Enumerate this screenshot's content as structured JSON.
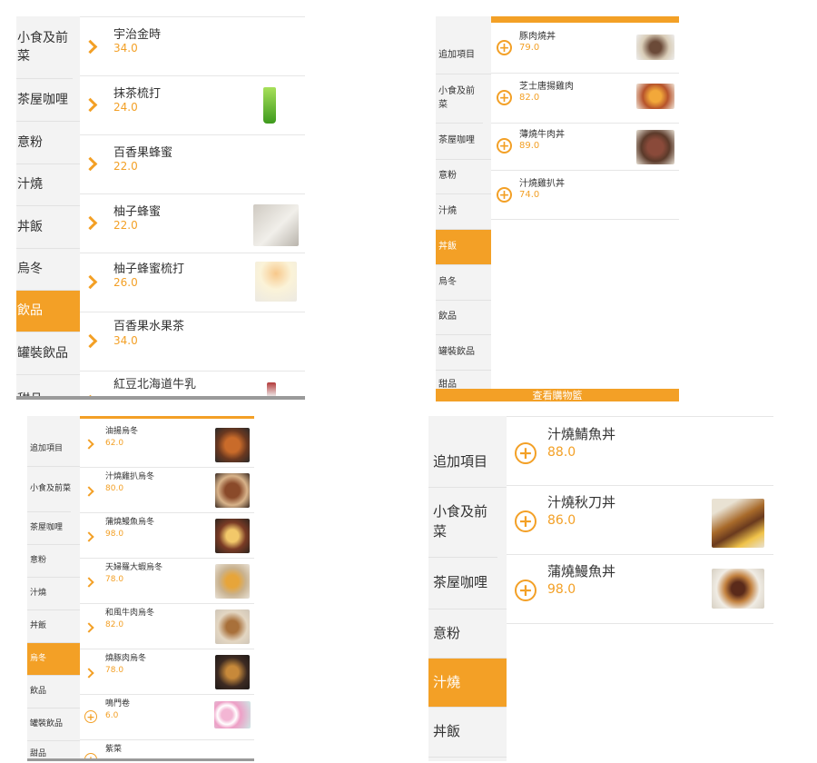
{
  "panel1": {
    "categories": [
      "小食及前菜",
      "茶屋咖哩",
      "意粉",
      "汁燒",
      "丼飯",
      "烏冬",
      "飲品",
      "罐裝飲品",
      "甜品"
    ],
    "active_index": 6,
    "items": [
      {
        "name": "宇治金時",
        "price": "34.0"
      },
      {
        "name": "抹茶梳打",
        "price": "24.0"
      },
      {
        "name": "百香果蜂蜜",
        "price": "22.0"
      },
      {
        "name": "柚子蜂蜜",
        "price": "22.0"
      },
      {
        "name": "柚子蜂蜜梳打",
        "price": "26.0"
      },
      {
        "name": "百香果水果茶",
        "price": "34.0"
      },
      {
        "name": "紅豆北海道牛乳",
        "price": ""
      }
    ]
  },
  "panel2": {
    "categories": [
      "追加項目",
      "小食及前菜",
      "茶屋咖哩",
      "意粉",
      "汁燒",
      "丼飯",
      "烏冬",
      "飲品",
      "罐裝飲品",
      "甜品"
    ],
    "active_index": 5,
    "items": [
      {
        "name": "豚肉燒丼",
        "price": "79.0"
      },
      {
        "name": "芝士唐揚雞肉",
        "price": "82.0"
      },
      {
        "name": "薄燒牛肉丼",
        "price": "89.0"
      },
      {
        "name": "汁燒雞扒丼",
        "price": "74.0"
      }
    ],
    "bottom_bar": "查看購物籃"
  },
  "panel3": {
    "categories": [
      "追加項目",
      "小食及前菜",
      "茶屋咖哩",
      "意粉",
      "汁燒",
      "丼飯",
      "烏冬",
      "飲品",
      "罐裝飲品",
      "甜品"
    ],
    "active_index": 6,
    "items": [
      {
        "name": "油揚烏冬",
        "price": "62.0"
      },
      {
        "name": "汁燒雞扒烏冬",
        "price": "80.0"
      },
      {
        "name": "蒲燒鰻魚烏冬",
        "price": "98.0"
      },
      {
        "name": "天婦羅大蝦烏冬",
        "price": "78.0"
      },
      {
        "name": "和風牛肉烏冬",
        "price": "82.0"
      },
      {
        "name": "燒豚肉烏冬",
        "price": "78.0"
      },
      {
        "name": "鳴門卷",
        "price": "6.0"
      },
      {
        "name": "紫菜",
        "price": ""
      }
    ]
  },
  "panel4": {
    "categories": [
      "追加項目",
      "小食及前菜",
      "茶屋咖哩",
      "意粉",
      "汁燒",
      "丼飯"
    ],
    "active_index": 4,
    "items": [
      {
        "name": "汁燒鯖魚丼",
        "price": "88.0"
      },
      {
        "name": "汁燒秋刀丼",
        "price": "86.0"
      },
      {
        "name": "蒲燒鰻魚丼",
        "price": "98.0"
      }
    ]
  },
  "colors": {
    "accent": "#f3a026",
    "sidebar_bg": "#f3f3f3",
    "text": "#333333"
  },
  "icons": [
    "search-icon",
    "chevron-right-icon",
    "add-circle-icon",
    "cart-icon"
  ]
}
